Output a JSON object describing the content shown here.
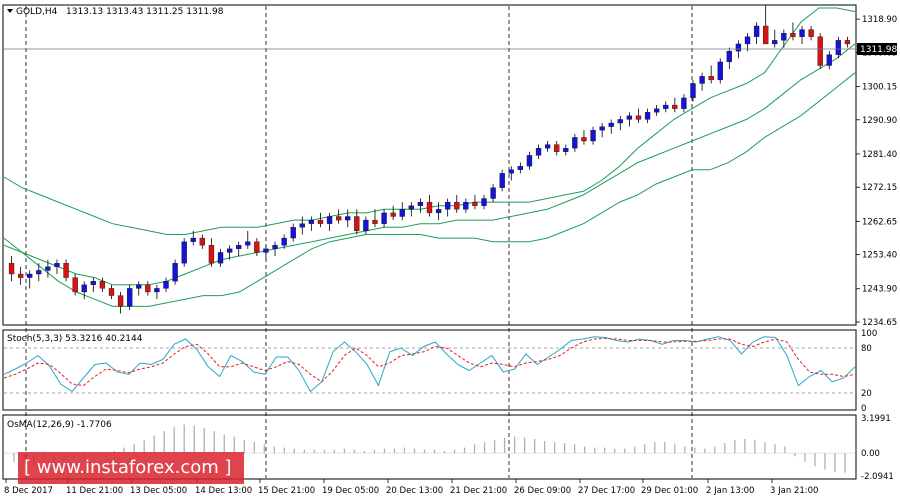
{
  "header": {
    "symbol": "GOLD,H4",
    "ohlc": "1313.13 1313.43 1311.25 1311.98"
  },
  "price_tag": "1311.98",
  "stoch_label": "Stoch(5,3,3) 53.3216 40.2144",
  "osma_label": "OsMA(12,26,9) -1.7706",
  "watermark": "[ www.instaforex.com ]",
  "colors": {
    "bull": "#1414d2",
    "bear": "#d21414",
    "band": "#1f9d55",
    "stoch_main": "#2aa7c9",
    "stoch_signal": "#e02020",
    "grid": "#000000",
    "osma": "#b0b0b0"
  },
  "chart_data": [
    {
      "type": "candlestick",
      "ylim": [
        1234.65,
        1322.0
      ],
      "price_ticks": [
        "1318.90",
        "1309.65",
        "1300.15",
        "1290.90",
        "1281.40",
        "1272.15",
        "1262.65",
        "1253.40",
        "1243.90",
        "1234.65"
      ],
      "x_labels": [
        "8 Dec 2017",
        "11 Dec 21:00",
        "13 Dec 05:00",
        "14 Dec 13:00",
        "15 Dec 21:00",
        "19 Dec 05:00",
        "20 Dec 13:00",
        "21 Dec 21:00",
        "26 Dec 09:00",
        "27 Dec 17:00",
        "29 Dec 01:00",
        "2 Jan 13:00",
        "3 Jan 21:00"
      ],
      "candles": [
        [
          1251,
          1253,
          1246,
          1248
        ],
        [
          1248,
          1250,
          1245,
          1247
        ],
        [
          1247,
          1249,
          1244,
          1248
        ],
        [
          1248,
          1251,
          1246,
          1249
        ],
        [
          1249,
          1252,
          1247,
          1250
        ],
        [
          1250,
          1252,
          1248,
          1251
        ],
        [
          1251,
          1252,
          1246,
          1247
        ],
        [
          1247,
          1248,
          1242,
          1243
        ],
        [
          1243,
          1246,
          1241,
          1245
        ],
        [
          1245,
          1247,
          1243,
          1246
        ],
        [
          1246,
          1247,
          1243,
          1244
        ],
        [
          1244,
          1245,
          1241,
          1242
        ],
        [
          1242,
          1243,
          1237,
          1239
        ],
        [
          1239,
          1245,
          1238,
          1244
        ],
        [
          1244,
          1246,
          1242,
          1245
        ],
        [
          1245,
          1246,
          1242,
          1243
        ],
        [
          1243,
          1245,
          1241,
          1244
        ],
        [
          1244,
          1247,
          1243,
          1246
        ],
        [
          1246,
          1252,
          1245,
          1251
        ],
        [
          1251,
          1258,
          1250,
          1257
        ],
        [
          1257,
          1260,
          1256,
          1258
        ],
        [
          1258,
          1259,
          1255,
          1256
        ],
        [
          1256,
          1258,
          1250,
          1251
        ],
        [
          1251,
          1255,
          1250,
          1254
        ],
        [
          1254,
          1256,
          1252,
          1255
        ],
        [
          1255,
          1257,
          1253,
          1256
        ],
        [
          1256,
          1260,
          1255,
          1257
        ],
        [
          1257,
          1258,
          1253,
          1254
        ],
        [
          1254,
          1256,
          1252,
          1255
        ],
        [
          1255,
          1257,
          1253,
          1256
        ],
        [
          1256,
          1259,
          1255,
          1258
        ],
        [
          1258,
          1262,
          1257,
          1261
        ],
        [
          1261,
          1264,
          1259,
          1262
        ],
        [
          1262,
          1264,
          1260,
          1263
        ],
        [
          1263,
          1265,
          1261,
          1262
        ],
        [
          1262,
          1265,
          1260,
          1264
        ],
        [
          1264,
          1266,
          1262,
          1263
        ],
        [
          1263,
          1266,
          1261,
          1264
        ],
        [
          1264,
          1266,
          1259,
          1260
        ],
        [
          1260,
          1264,
          1259,
          1263
        ],
        [
          1263,
          1266,
          1261,
          1262
        ],
        [
          1262,
          1266,
          1261,
          1265
        ],
        [
          1265,
          1267,
          1263,
          1264
        ],
        [
          1264,
          1268,
          1263,
          1266
        ],
        [
          1266,
          1268,
          1264,
          1267
        ],
        [
          1267,
          1269,
          1265,
          1268
        ],
        [
          1268,
          1270,
          1264,
          1265
        ],
        [
          1265,
          1268,
          1263,
          1266
        ],
        [
          1266,
          1269,
          1264,
          1268
        ],
        [
          1268,
          1270,
          1265,
          1266
        ],
        [
          1266,
          1269,
          1265,
          1268
        ],
        [
          1268,
          1270,
          1266,
          1267
        ],
        [
          1267,
          1270,
          1266,
          1269
        ],
        [
          1269,
          1273,
          1268,
          1272
        ],
        [
          1272,
          1277,
          1271,
          1276
        ],
        [
          1276,
          1278,
          1274,
          1277
        ],
        [
          1277,
          1279,
          1276,
          1278
        ],
        [
          1278,
          1282,
          1277,
          1281
        ],
        [
          1281,
          1284,
          1280,
          1283
        ],
        [
          1283,
          1285,
          1282,
          1284
        ],
        [
          1284,
          1285,
          1281,
          1282
        ],
        [
          1282,
          1284,
          1281,
          1283
        ],
        [
          1283,
          1287,
          1282,
          1286
        ],
        [
          1286,
          1288,
          1284,
          1285
        ],
        [
          1285,
          1289,
          1284,
          1288
        ],
        [
          1288,
          1290,
          1286,
          1289
        ],
        [
          1289,
          1291,
          1287,
          1290
        ],
        [
          1290,
          1292,
          1288,
          1291
        ],
        [
          1291,
          1293,
          1289,
          1292
        ],
        [
          1292,
          1294,
          1290,
          1291
        ],
        [
          1291,
          1294,
          1290,
          1293
        ],
        [
          1293,
          1295,
          1292,
          1294
        ],
        [
          1294,
          1296,
          1293,
          1295
        ],
        [
          1295,
          1297,
          1293,
          1294
        ],
        [
          1294,
          1298,
          1293,
          1297
        ],
        [
          1297,
          1302,
          1296,
          1301
        ],
        [
          1301,
          1304,
          1299,
          1303
        ],
        [
          1303,
          1306,
          1301,
          1302
        ],
        [
          1302,
          1308,
          1301,
          1307
        ],
        [
          1307,
          1311,
          1305,
          1310
        ],
        [
          1310,
          1313,
          1308,
          1312
        ],
        [
          1312,
          1315,
          1310,
          1314
        ],
        [
          1314,
          1318,
          1312,
          1317
        ],
        [
          1317,
          1323,
          1315,
          1312
        ],
        [
          1312,
          1316,
          1311,
          1313
        ],
        [
          1313,
          1316,
          1311,
          1315
        ],
        [
          1315,
          1318,
          1313,
          1314
        ],
        [
          1314,
          1317,
          1312,
          1316
        ],
        [
          1316,
          1317,
          1313,
          1314
        ],
        [
          1314,
          1315,
          1305,
          1306
        ],
        [
          1306,
          1310,
          1305,
          1309
        ],
        [
          1309,
          1314,
          1308,
          1313
        ],
        [
          1313,
          1314,
          1311,
          1312
        ]
      ],
      "bands": {
        "upper": [
          1275,
          1272,
          1270,
          1268,
          1266,
          1264,
          1262,
          1261,
          1260,
          1259,
          1259,
          1260,
          1261,
          1261,
          1261,
          1262,
          1263,
          1263,
          1264,
          1265,
          1265,
          1266,
          1266,
          1266,
          1267,
          1267,
          1268,
          1268,
          1268,
          1268,
          1269,
          1270,
          1271,
          1274,
          1278,
          1283,
          1287,
          1291,
          1294,
          1297,
          1299,
          1301,
          1304,
          1311,
          1318,
          1322,
          1322,
          1321
        ],
        "middle": [
          1256,
          1254,
          1252,
          1250,
          1248,
          1247,
          1245,
          1245,
          1245,
          1246,
          1248,
          1250,
          1252,
          1253,
          1254,
          1255,
          1256,
          1257,
          1258,
          1259,
          1260,
          1261,
          1261,
          1262,
          1262,
          1263,
          1263,
          1263,
          1264,
          1265,
          1266,
          1268,
          1270,
          1273,
          1276,
          1279,
          1281,
          1283,
          1285,
          1287,
          1289,
          1291,
          1294,
          1298,
          1302,
          1305,
          1308,
          1312
        ],
        "lower": [
          1258,
          1254,
          1250,
          1246,
          1243,
          1241,
          1239,
          1239,
          1239,
          1240,
          1241,
          1242,
          1242,
          1243,
          1246,
          1249,
          1252,
          1255,
          1257,
          1258,
          1259,
          1259,
          1259,
          1259,
          1258,
          1258,
          1258,
          1257,
          1257,
          1257,
          1258,
          1260,
          1262,
          1265,
          1268,
          1270,
          1273,
          1275,
          1277,
          1277,
          1279,
          1282,
          1286,
          1289,
          1292,
          1296,
          1300,
          1304
        ]
      }
    },
    {
      "type": "line",
      "ylim": [
        0,
        100
      ],
      "ticks": [
        "100",
        "80",
        "20",
        "0"
      ],
      "series": [
        {
          "values": [
            45,
            52,
            60,
            70,
            56,
            32,
            22,
            40,
            58,
            60,
            48,
            45,
            60,
            58,
            65,
            85,
            92,
            78,
            55,
            42,
            70,
            62,
            48,
            45,
            68,
            68,
            50,
            22,
            35,
            75,
            88,
            75,
            58,
            30,
            75,
            80,
            70,
            82,
            88,
            72,
            58,
            50,
            60,
            70,
            48,
            52,
            72,
            58,
            68,
            78,
            90,
            92,
            95,
            94,
            90,
            88,
            92,
            90,
            85,
            90,
            90,
            88,
            92,
            95,
            90,
            72,
            88,
            95,
            94,
            70,
            30,
            42,
            50,
            35,
            40,
            55
          ]
        },
        {
          "values": [
            40,
            45,
            52,
            60,
            58,
            46,
            32,
            30,
            42,
            52,
            50,
            47,
            52,
            55,
            60,
            72,
            82,
            85,
            72,
            55,
            55,
            60,
            55,
            50,
            55,
            62,
            58,
            45,
            35,
            50,
            70,
            80,
            70,
            55,
            60,
            70,
            72,
            75,
            82,
            80,
            70,
            60,
            55,
            60,
            58,
            55,
            60,
            62,
            65,
            70,
            80,
            88,
            92,
            93,
            92,
            90,
            90,
            90,
            88,
            88,
            89,
            89,
            90,
            92,
            92,
            85,
            82,
            88,
            92,
            88,
            65,
            48,
            45,
            45,
            42,
            45
          ]
        }
      ]
    },
    {
      "type": "bar",
      "ylim": [
        -2.0941,
        3.1991
      ],
      "ticks": [
        "3.1991",
        "0.00",
        "-2.0941"
      ],
      "values": [
        -0.8,
        -1.0,
        -1.2,
        -1.1,
        -0.9,
        -0.7,
        -0.5,
        -0.4,
        -0.3,
        -0.2,
        0.2,
        0.5,
        0.8,
        1.2,
        1.6,
        2.0,
        2.4,
        2.6,
        2.5,
        2.3,
        2.0,
        1.7,
        1.5,
        1.2,
        1.0,
        0.8,
        0.6,
        0.5,
        0.4,
        0.3,
        0.3,
        0.3,
        0.3,
        0.4,
        0.3,
        0.2,
        0.3,
        0.4,
        0.4,
        0.5,
        0.4,
        0.3,
        0.3,
        0.2,
        0.3,
        0.5,
        0.8,
        1.0,
        1.2,
        1.4,
        1.5,
        1.4,
        1.3,
        1.1,
        1.0,
        0.9,
        0.8,
        0.6,
        0.5,
        0.5,
        0.4,
        0.4,
        0.6,
        0.8,
        1.0,
        1.0,
        0.8,
        0.6,
        0.5,
        0.4,
        0.6,
        0.9,
        1.2,
        1.3,
        1.2,
        1.0,
        0.8,
        0.6,
        -0.3,
        -0.8,
        -1.2,
        -1.5,
        -1.7,
        -1.8
      ]
    }
  ]
}
